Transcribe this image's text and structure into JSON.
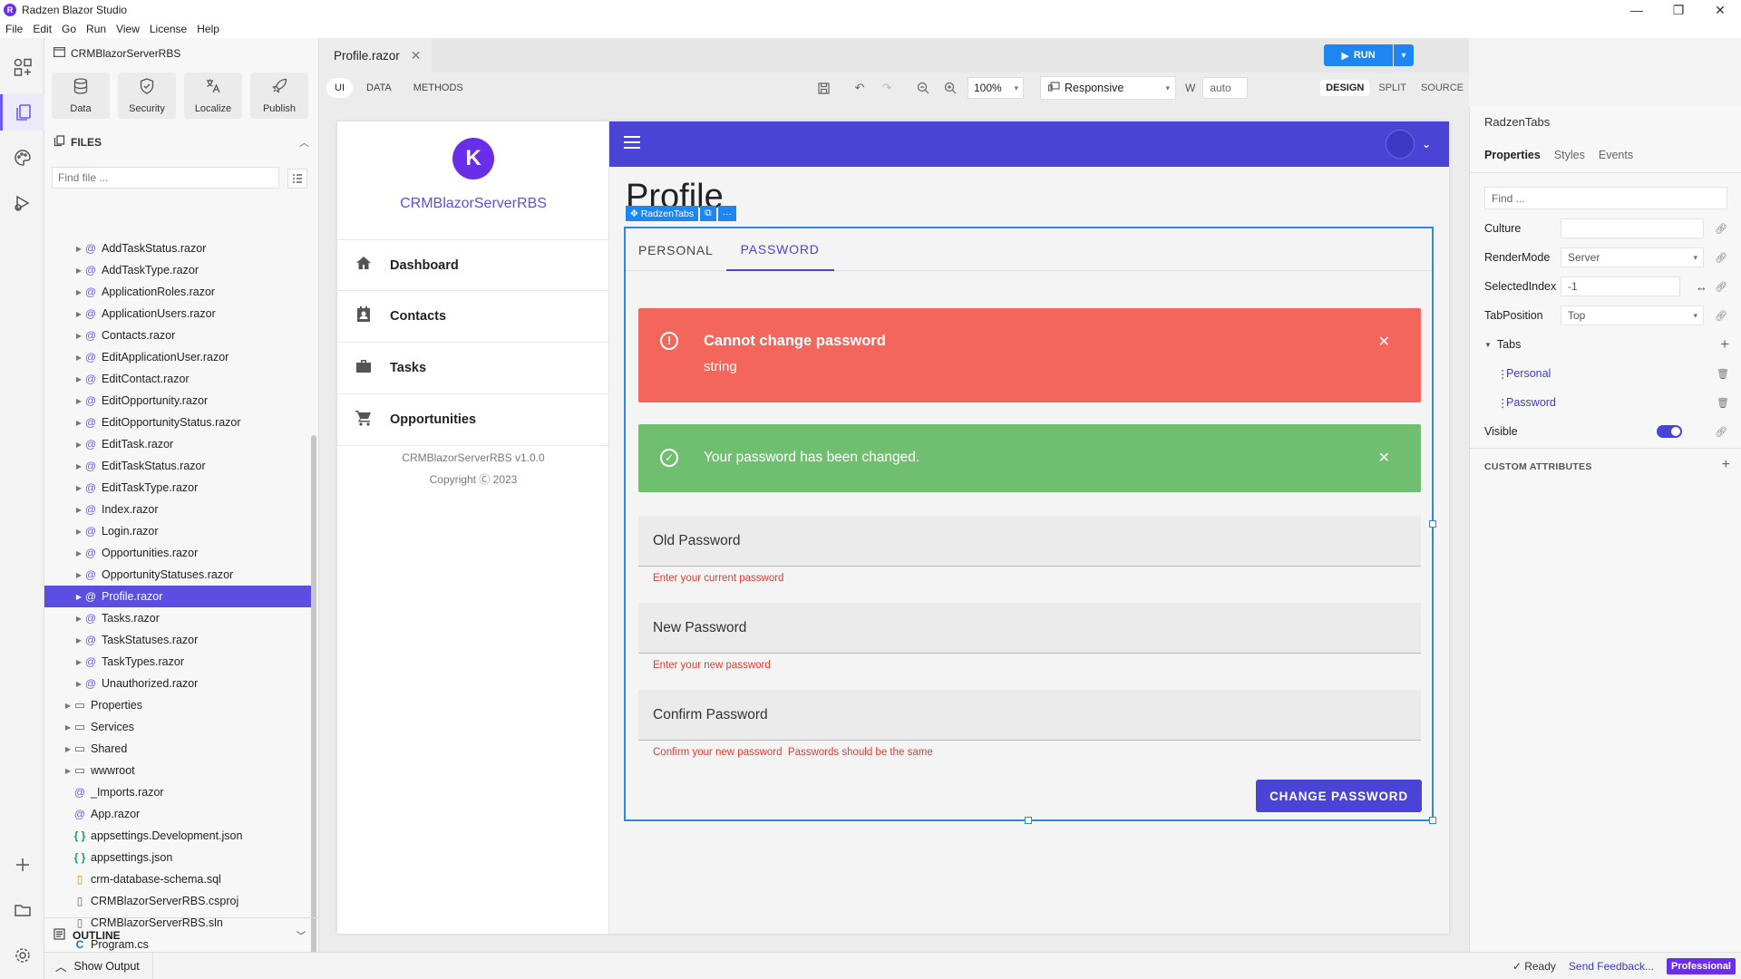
{
  "window": {
    "title": "Radzen Blazor Studio",
    "controls": [
      "—",
      "❐",
      "✕"
    ]
  },
  "menu": [
    "File",
    "Edit",
    "Go",
    "Run",
    "View",
    "License",
    "Help"
  ],
  "sidebar": {
    "project": "CRMBlazorServerRBS",
    "tools": [
      {
        "label": "Data",
        "icon": "database-icon"
      },
      {
        "label": "Security",
        "icon": "shield-icon"
      },
      {
        "label": "Localize",
        "icon": "translate-icon"
      },
      {
        "label": "Publish",
        "icon": "rocket-icon"
      }
    ],
    "files_header": "FILES",
    "find_placeholder": "Find file ...",
    "files": [
      {
        "name": "AddTaskStatus.razor",
        "type": "razor",
        "indent": 2,
        "caret": true
      },
      {
        "name": "AddTaskType.razor",
        "type": "razor",
        "indent": 2,
        "caret": true
      },
      {
        "name": "ApplicationRoles.razor",
        "type": "razor",
        "indent": 2,
        "caret": true
      },
      {
        "name": "ApplicationUsers.razor",
        "type": "razor",
        "indent": 2,
        "caret": true
      },
      {
        "name": "Contacts.razor",
        "type": "razor",
        "indent": 2,
        "caret": true
      },
      {
        "name": "EditApplicationUser.razor",
        "type": "razor",
        "indent": 2,
        "caret": true
      },
      {
        "name": "EditContact.razor",
        "type": "razor",
        "indent": 2,
        "caret": true
      },
      {
        "name": "EditOpportunity.razor",
        "type": "razor",
        "indent": 2,
        "caret": true
      },
      {
        "name": "EditOpportunityStatus.razor",
        "type": "razor",
        "indent": 2,
        "caret": true
      },
      {
        "name": "EditTask.razor",
        "type": "razor",
        "indent": 2,
        "caret": true
      },
      {
        "name": "EditTaskStatus.razor",
        "type": "razor",
        "indent": 2,
        "caret": true
      },
      {
        "name": "EditTaskType.razor",
        "type": "razor",
        "indent": 2,
        "caret": true
      },
      {
        "name": "Index.razor",
        "type": "razor",
        "indent": 2,
        "caret": true
      },
      {
        "name": "Login.razor",
        "type": "razor",
        "indent": 2,
        "caret": true
      },
      {
        "name": "Opportunities.razor",
        "type": "razor",
        "indent": 2,
        "caret": true
      },
      {
        "name": "OpportunityStatuses.razor",
        "type": "razor",
        "indent": 2,
        "caret": true
      },
      {
        "name": "Profile.razor",
        "type": "razor",
        "indent": 2,
        "caret": true,
        "selected": true
      },
      {
        "name": "Tasks.razor",
        "type": "razor",
        "indent": 2,
        "caret": true
      },
      {
        "name": "TaskStatuses.razor",
        "type": "razor",
        "indent": 2,
        "caret": true
      },
      {
        "name": "TaskTypes.razor",
        "type": "razor",
        "indent": 2,
        "caret": true
      },
      {
        "name": "Unauthorized.razor",
        "type": "razor",
        "indent": 2,
        "caret": true
      },
      {
        "name": "Properties",
        "type": "folder",
        "indent": 1,
        "caret": true
      },
      {
        "name": "Services",
        "type": "folder",
        "indent": 1,
        "caret": true
      },
      {
        "name": "Shared",
        "type": "folder",
        "indent": 1,
        "caret": true
      },
      {
        "name": "wwwroot",
        "type": "folder",
        "indent": 1,
        "caret": true
      },
      {
        "name": "_Imports.razor",
        "type": "razor",
        "indent": 1,
        "caret": false
      },
      {
        "name": "App.razor",
        "type": "razor",
        "indent": 1,
        "caret": false
      },
      {
        "name": "appsettings.Development.json",
        "type": "json",
        "indent": 1,
        "caret": false
      },
      {
        "name": "appsettings.json",
        "type": "json",
        "indent": 1,
        "caret": false
      },
      {
        "name": "crm-database-schema.sql",
        "type": "sql",
        "indent": 1,
        "caret": false
      },
      {
        "name": "CRMBlazorServerRBS.csproj",
        "type": "doc",
        "indent": 1,
        "caret": false
      },
      {
        "name": "CRMBlazorServerRBS.sln",
        "type": "doc",
        "indent": 1,
        "caret": false
      },
      {
        "name": "Program.cs",
        "type": "cs",
        "indent": 1,
        "caret": false
      }
    ],
    "outline": "OUTLINE"
  },
  "statusbar": {
    "show_output": "Show Output",
    "ready": "Ready",
    "send_feedback": "Send Feedback...",
    "edition": "Professional"
  },
  "editor": {
    "tab": "Profile.razor",
    "modes": [
      "UI",
      "DATA",
      "METHODS"
    ],
    "zoom": "100%",
    "responsive": "Responsive",
    "w_label": "W",
    "w_value": "auto",
    "views": [
      "DESIGN",
      "SPLIT",
      "SOURCE"
    ],
    "run": "RUN"
  },
  "app": {
    "logo_letter": "K",
    "name": "CRMBlazorServerRBS",
    "nav": [
      {
        "label": "Dashboard",
        "icon": "home-icon"
      },
      {
        "label": "Contacts",
        "icon": "contact-icon"
      },
      {
        "label": "Tasks",
        "icon": "briefcase-icon"
      },
      {
        "label": "Opportunities",
        "icon": "cart-icon"
      }
    ],
    "version": "CRMBlazorServerRBS v1.0.0",
    "copyright": "Copyright Ⓒ 2023",
    "page_title": "Profile",
    "selection_badge": "RadzenTabs",
    "tabs": [
      "PERSONAL",
      "PASSWORD"
    ],
    "active_tab": 1,
    "error_alert": {
      "title": "Cannot change password",
      "message": "string"
    },
    "success_alert": {
      "message": "Your password has been changed."
    },
    "fields": [
      {
        "label": "Old Password",
        "error": "Enter your current password"
      },
      {
        "label": "New Password",
        "error": "Enter your new password"
      },
      {
        "label": "Confirm Password",
        "error": "Confirm your new password  Passwords should be the same"
      }
    ],
    "submit": "CHANGE PASSWORD",
    "colors": {
      "primary": "#4a44d6",
      "danger": "#f4665c",
      "success": "#70bf70",
      "selection": "#2f86e6"
    }
  },
  "properties": {
    "component": "RadzenTabs",
    "tabs": [
      "Properties",
      "Styles",
      "Events"
    ],
    "find_placeholder": "Find ...",
    "culture_label": "Culture",
    "culture_value": "",
    "rendermode_label": "RenderMode",
    "rendermode_value": "Server",
    "selectedindex_label": "SelectedIndex",
    "selectedindex_value": "-1",
    "tabposition_label": "TabPosition",
    "tabposition_value": "Top",
    "tabs_label": "Tabs",
    "tab_items": [
      "Personal",
      "Password"
    ],
    "visible_label": "Visible",
    "visible": true,
    "custom_attributes": "CUSTOM ATTRIBUTES"
  }
}
